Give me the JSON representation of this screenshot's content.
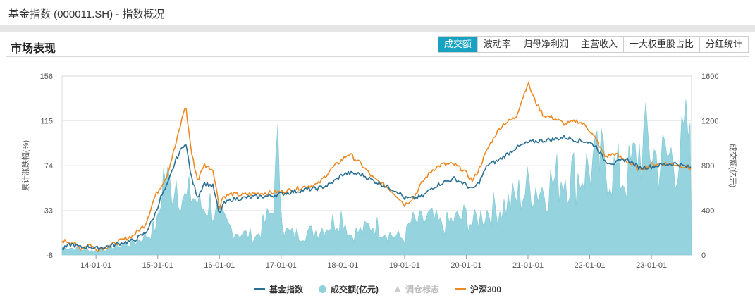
{
  "page": {
    "title": "基金指数 (000011.SH) - 指数概况"
  },
  "section": {
    "title": "市场表现"
  },
  "tabs": [
    {
      "label": "成交额",
      "active": true
    },
    {
      "label": "波动率",
      "active": false
    },
    {
      "label": "归母净利润",
      "active": false
    },
    {
      "label": "主营收入",
      "active": false
    },
    {
      "label": "十大权重股占比",
      "active": false
    },
    {
      "label": "分红统计",
      "active": false
    }
  ],
  "colors": {
    "accent": "#17a2c2",
    "fund_index": "#2a6f94",
    "turnover": "#8fd2dc",
    "hs300": "#ee8a24"
  },
  "chart_data": {
    "type": "line",
    "y_left_label": "累计涨跌幅(%)",
    "y_right_label": "成交额(亿元)",
    "y_left_ticks": [
      "156",
      "115",
      "74",
      "33",
      "-8"
    ],
    "y_right_ticks": [
      "1600",
      "1200",
      "800",
      "400",
      "0"
    ],
    "y_left_range": [
      -8,
      156
    ],
    "y_right_range": [
      0,
      1600
    ],
    "x_range": [
      2013.45,
      2023.65
    ],
    "x_ticks": [
      "14-01-01",
      "15-01-01",
      "16-01-01",
      "17-01-01",
      "18-01-01",
      "19-01-01",
      "20-01-01",
      "21-01-01",
      "22-01-01",
      "23-01-01"
    ],
    "legend": [
      {
        "name": "基金指数",
        "type": "line"
      },
      {
        "name": "成交额(亿元)",
        "type": "area"
      },
      {
        "name": "调仓标志",
        "type": "marker",
        "disabled": true
      },
      {
        "name": "沪深300",
        "type": "line"
      }
    ],
    "series": [
      {
        "name": "基金指数",
        "axis": "left",
        "x": [
          2013.45,
          2013.6,
          2013.75,
          2013.9,
          2014.0,
          2014.2,
          2014.4,
          2014.6,
          2014.8,
          2014.95,
          2015.05,
          2015.15,
          2015.3,
          2015.45,
          2015.55,
          2015.65,
          2015.75,
          2015.9,
          2016.0,
          2016.05,
          2016.2,
          2016.35,
          2016.5,
          2016.8,
          2017.0,
          2017.2,
          2017.4,
          2017.6,
          2017.8,
          2018.0,
          2018.1,
          2018.3,
          2018.5,
          2018.7,
          2018.9,
          2019.0,
          2019.15,
          2019.3,
          2019.45,
          2019.6,
          2019.8,
          2019.95,
          2020.1,
          2020.2,
          2020.35,
          2020.5,
          2020.6,
          2020.8,
          2021.0,
          2021.1,
          2021.25,
          2021.4,
          2021.6,
          2021.8,
          2021.95,
          2022.1,
          2022.25,
          2022.4,
          2022.6,
          2022.8,
          2023.0,
          2023.2,
          2023.4,
          2023.55,
          2023.65
        ],
        "values": [
          -3,
          2,
          -1,
          0,
          -2,
          0,
          3,
          5,
          12,
          28,
          45,
          55,
          80,
          96,
          62,
          45,
          58,
          55,
          28,
          38,
          43,
          44,
          45,
          46,
          48,
          50,
          52,
          53,
          57,
          66,
          67,
          66,
          60,
          55,
          50,
          44,
          44,
          46,
          54,
          58,
          62,
          58,
          52,
          58,
          75,
          78,
          82,
          90,
          95,
          96,
          97,
          98,
          100,
          97,
          96,
          92,
          78,
          76,
          80,
          72,
          73,
          75,
          76,
          73,
          72
        ]
      },
      {
        "name": "成交额(亿元)",
        "axis": "right",
        "x": [
          2013.45,
          2013.7,
          2014.0,
          2014.3,
          2014.6,
          2014.85,
          2015.0,
          2015.1,
          2015.2,
          2015.3,
          2015.45,
          2015.55,
          2015.7,
          2015.85,
          2016.0,
          2016.2,
          2016.4,
          2016.6,
          2016.85,
          2016.95,
          2017.05,
          2017.2,
          2017.5,
          2017.8,
          2018.0,
          2018.1,
          2018.3,
          2018.5,
          2018.8,
          2019.0,
          2019.1,
          2019.2,
          2019.4,
          2019.6,
          2019.8,
          2020.0,
          2020.1,
          2020.3,
          2020.5,
          2020.7,
          2020.9,
          2021.05,
          2021.2,
          2021.4,
          2021.6,
          2021.8,
          2022.0,
          2022.2,
          2022.4,
          2022.6,
          2022.8,
          2022.95,
          2023.1,
          2023.3,
          2023.5,
          2023.6,
          2023.65
        ],
        "values": [
          80,
          60,
          40,
          80,
          120,
          200,
          300,
          800,
          650,
          750,
          500,
          600,
          450,
          500,
          350,
          250,
          200,
          180,
          420,
          980,
          230,
          200,
          220,
          300,
          400,
          200,
          230,
          300,
          190,
          160,
          320,
          300,
          360,
          280,
          330,
          380,
          300,
          420,
          450,
          500,
          600,
          680,
          640,
          700,
          800,
          760,
          850,
          900,
          800,
          750,
          1000,
          1100,
          900,
          950,
          1000,
          1200,
          800
        ]
      },
      {
        "name": "沪深300",
        "axis": "left",
        "x": [
          2013.45,
          2013.6,
          2013.75,
          2013.9,
          2014.0,
          2014.2,
          2014.4,
          2014.6,
          2014.8,
          2014.95,
          2015.05,
          2015.15,
          2015.3,
          2015.45,
          2015.55,
          2015.65,
          2015.75,
          2015.9,
          2016.0,
          2016.05,
          2016.2,
          2016.35,
          2016.5,
          2016.8,
          2017.0,
          2017.2,
          2017.4,
          2017.6,
          2017.8,
          2018.0,
          2018.1,
          2018.3,
          2018.5,
          2018.7,
          2018.9,
          2019.0,
          2019.15,
          2019.3,
          2019.45,
          2019.6,
          2019.8,
          2019.95,
          2020.1,
          2020.2,
          2020.35,
          2020.5,
          2020.6,
          2020.8,
          2021.0,
          2021.1,
          2021.25,
          2021.4,
          2021.6,
          2021.8,
          2021.95,
          2022.1,
          2022.25,
          2022.4,
          2022.6,
          2022.8,
          2023.0,
          2023.2,
          2023.4,
          2023.55,
          2023.65
        ],
        "values": [
          5,
          4,
          -2,
          2,
          -3,
          0,
          5,
          10,
          20,
          45,
          55,
          65,
          95,
          130,
          85,
          60,
          75,
          70,
          35,
          45,
          48,
          47,
          48,
          49,
          50,
          52,
          55,
          57,
          70,
          80,
          85,
          75,
          62,
          55,
          45,
          38,
          45,
          60,
          70,
          75,
          75,
          70,
          60,
          70,
          90,
          105,
          112,
          118,
          150,
          135,
          120,
          118,
          112,
          115,
          110,
          98,
          82,
          85,
          78,
          70,
          75,
          76,
          75,
          73,
          71
        ]
      }
    ]
  }
}
